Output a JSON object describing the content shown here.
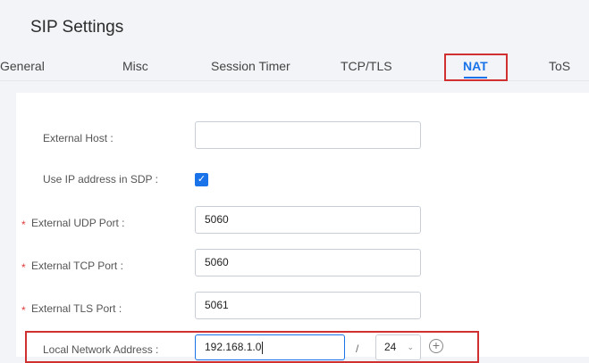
{
  "page": {
    "title": "SIP Settings"
  },
  "tabs": [
    {
      "label": "General"
    },
    {
      "label": "Misc"
    },
    {
      "label": "Session Timer"
    },
    {
      "label": "TCP/TLS"
    },
    {
      "label": "NAT"
    },
    {
      "label": "ToS"
    }
  ],
  "active_tab": "NAT",
  "form": {
    "external_host": {
      "label": "External Host :",
      "value": ""
    },
    "use_ip_in_sdp": {
      "label": "Use IP address in SDP :",
      "checked": true,
      "check_glyph": "✓"
    },
    "external_udp_port": {
      "label": "External UDP Port :",
      "value": "5060",
      "required_mark": "*"
    },
    "external_tcp_port": {
      "label": "External TCP Port :",
      "value": "5060",
      "required_mark": "*"
    },
    "external_tls_port": {
      "label": "External TLS Port :",
      "value": "5061",
      "required_mark": "*"
    },
    "local_network": {
      "label": "Local Network Address :",
      "value": "192.168.1.0",
      "separator": "/",
      "mask": "24",
      "mask_icon": "chevron-down-icon",
      "add_icon": "plus-circle-icon",
      "add_glyph": "+"
    }
  },
  "colors": {
    "accent": "#1a73e8",
    "highlight": "#d03030",
    "required": "#e03a3a"
  }
}
